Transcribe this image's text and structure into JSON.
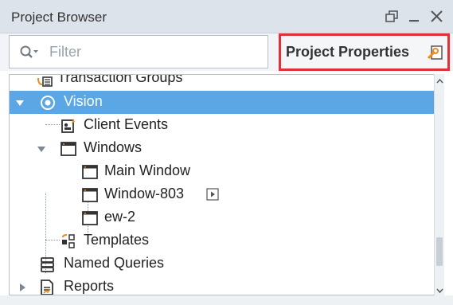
{
  "window": {
    "title": "Project Browser",
    "controls": [
      "restore-icon",
      "minimize-icon",
      "close-icon"
    ]
  },
  "filter": {
    "placeholder": "Filter",
    "icon": "search-dropdown-icon"
  },
  "project_properties": {
    "label": "Project Properties",
    "icon": "project-properties-icon",
    "highlight_color": "#e0303a"
  },
  "tree": {
    "selection_color": "#5ba7e6",
    "items": [
      {
        "label": "Transaction Groups",
        "icon": "transaction-groups-icon",
        "state": "leaf"
      },
      {
        "label": "Vision",
        "icon": "vision-icon",
        "state": "expanded",
        "selected": true
      },
      {
        "label": "Client Events",
        "icon": "client-events-icon",
        "state": "leaf"
      },
      {
        "label": "Windows",
        "icon": "window-folder-icon",
        "state": "expanded"
      },
      {
        "label": "Main Window",
        "icon": "window-icon",
        "state": "leaf"
      },
      {
        "label": "Window-803",
        "icon": "window-icon",
        "state": "leaf",
        "badge": "open-play-icon"
      },
      {
        "label": "ew-2",
        "icon": "window-icon",
        "state": "leaf"
      },
      {
        "label": "Templates",
        "icon": "templates-icon",
        "state": "leaf"
      },
      {
        "label": "Named Queries",
        "icon": "named-queries-icon",
        "state": "leaf"
      },
      {
        "label": "Reports",
        "icon": "reports-icon",
        "state": "collapsed"
      }
    ]
  }
}
